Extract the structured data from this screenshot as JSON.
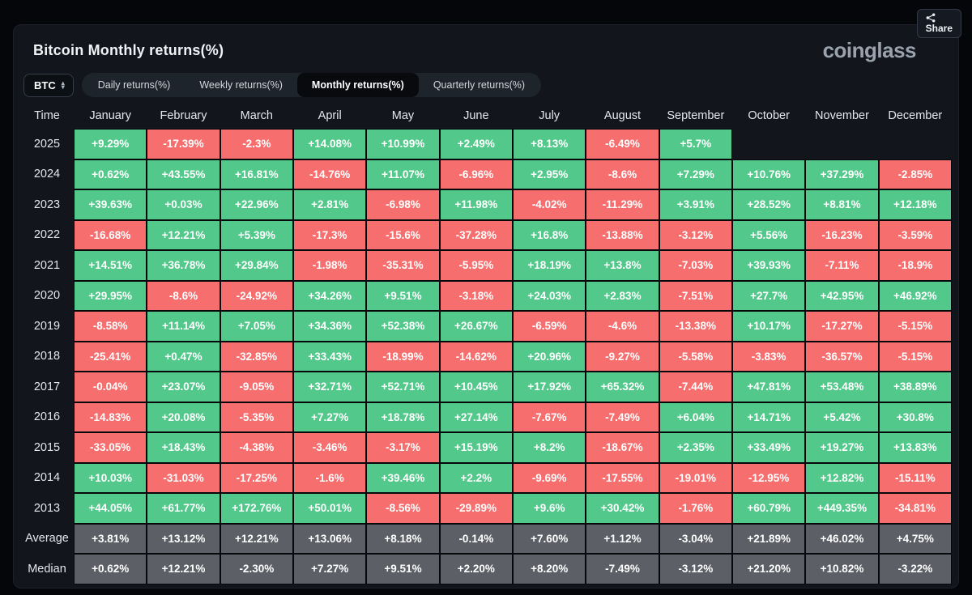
{
  "page": {
    "title": "Bitcoin Monthly returns(%)",
    "logo_text": "coinglass",
    "share_label": "Share"
  },
  "symbol_select": {
    "value": "BTC"
  },
  "tabs": [
    {
      "label": "Daily returns(%)",
      "active": false
    },
    {
      "label": "Weekly returns(%)",
      "active": false
    },
    {
      "label": "Monthly returns(%)",
      "active": true
    },
    {
      "label": "Quarterly returns(%)",
      "active": false
    }
  ],
  "colors": {
    "positive": "#52c98b",
    "negative": "#f66e6e",
    "summary": "#5c5f66"
  },
  "table": {
    "columns": [
      "Time",
      "January",
      "February",
      "March",
      "April",
      "May",
      "June",
      "July",
      "August",
      "September",
      "October",
      "November",
      "December"
    ],
    "rows": [
      {
        "label": "2025",
        "kind": "year",
        "cells": [
          "+9.29%",
          "-17.39%",
          "-2.3%",
          "+14.08%",
          "+10.99%",
          "+2.49%",
          "+8.13%",
          "-6.49%",
          "+5.7%",
          null,
          null,
          null
        ]
      },
      {
        "label": "2024",
        "kind": "year",
        "cells": [
          "+0.62%",
          "+43.55%",
          "+16.81%",
          "-14.76%",
          "+11.07%",
          "-6.96%",
          "+2.95%",
          "-8.6%",
          "+7.29%",
          "+10.76%",
          "+37.29%",
          "-2.85%"
        ]
      },
      {
        "label": "2023",
        "kind": "year",
        "cells": [
          "+39.63%",
          "+0.03%",
          "+22.96%",
          "+2.81%",
          "-6.98%",
          "+11.98%",
          "-4.02%",
          "-11.29%",
          "+3.91%",
          "+28.52%",
          "+8.81%",
          "+12.18%"
        ]
      },
      {
        "label": "2022",
        "kind": "year",
        "cells": [
          "-16.68%",
          "+12.21%",
          "+5.39%",
          "-17.3%",
          "-15.6%",
          "-37.28%",
          "+16.8%",
          "-13.88%",
          "-3.12%",
          "+5.56%",
          "-16.23%",
          "-3.59%"
        ]
      },
      {
        "label": "2021",
        "kind": "year",
        "cells": [
          "+14.51%",
          "+36.78%",
          "+29.84%",
          "-1.98%",
          "-35.31%",
          "-5.95%",
          "+18.19%",
          "+13.8%",
          "-7.03%",
          "+39.93%",
          "-7.11%",
          "-18.9%"
        ]
      },
      {
        "label": "2020",
        "kind": "year",
        "cells": [
          "+29.95%",
          "-8.6%",
          "-24.92%",
          "+34.26%",
          "+9.51%",
          "-3.18%",
          "+24.03%",
          "+2.83%",
          "-7.51%",
          "+27.7%",
          "+42.95%",
          "+46.92%"
        ]
      },
      {
        "label": "2019",
        "kind": "year",
        "cells": [
          "-8.58%",
          "+11.14%",
          "+7.05%",
          "+34.36%",
          "+52.38%",
          "+26.67%",
          "-6.59%",
          "-4.6%",
          "-13.38%",
          "+10.17%",
          "-17.27%",
          "-5.15%"
        ]
      },
      {
        "label": "2018",
        "kind": "year",
        "cells": [
          "-25.41%",
          "+0.47%",
          "-32.85%",
          "+33.43%",
          "-18.99%",
          "-14.62%",
          "+20.96%",
          "-9.27%",
          "-5.58%",
          "-3.83%",
          "-36.57%",
          "-5.15%"
        ]
      },
      {
        "label": "2017",
        "kind": "year",
        "cells": [
          "-0.04%",
          "+23.07%",
          "-9.05%",
          "+32.71%",
          "+52.71%",
          "+10.45%",
          "+17.92%",
          "+65.32%",
          "-7.44%",
          "+47.81%",
          "+53.48%",
          "+38.89%"
        ]
      },
      {
        "label": "2016",
        "kind": "year",
        "cells": [
          "-14.83%",
          "+20.08%",
          "-5.35%",
          "+7.27%",
          "+18.78%",
          "+27.14%",
          "-7.67%",
          "-7.49%",
          "+6.04%",
          "+14.71%",
          "+5.42%",
          "+30.8%"
        ]
      },
      {
        "label": "2015",
        "kind": "year",
        "cells": [
          "-33.05%",
          "+18.43%",
          "-4.38%",
          "-3.46%",
          "-3.17%",
          "+15.19%",
          "+8.2%",
          "-18.67%",
          "+2.35%",
          "+33.49%",
          "+19.27%",
          "+13.83%"
        ]
      },
      {
        "label": "2014",
        "kind": "year",
        "cells": [
          "+10.03%",
          "-31.03%",
          "-17.25%",
          "-1.6%",
          "+39.46%",
          "+2.2%",
          "-9.69%",
          "-17.55%",
          "-19.01%",
          "-12.95%",
          "+12.82%",
          "-15.11%"
        ]
      },
      {
        "label": "2013",
        "kind": "year",
        "cells": [
          "+44.05%",
          "+61.77%",
          "+172.76%",
          "+50.01%",
          "-8.56%",
          "-29.89%",
          "+9.6%",
          "+30.42%",
          "-1.76%",
          "+60.79%",
          "+449.35%",
          "-34.81%"
        ]
      },
      {
        "label": "Average",
        "kind": "summary",
        "cells": [
          "+3.81%",
          "+13.12%",
          "+12.21%",
          "+13.06%",
          "+8.18%",
          "-0.14%",
          "+7.60%",
          "+1.12%",
          "-3.04%",
          "+21.89%",
          "+46.02%",
          "+4.75%"
        ]
      },
      {
        "label": "Median",
        "kind": "summary",
        "cells": [
          "+0.62%",
          "+12.21%",
          "-2.30%",
          "+7.27%",
          "+9.51%",
          "+2.20%",
          "+8.20%",
          "-7.49%",
          "-3.12%",
          "+21.20%",
          "+10.82%",
          "-3.22%"
        ]
      }
    ]
  }
}
